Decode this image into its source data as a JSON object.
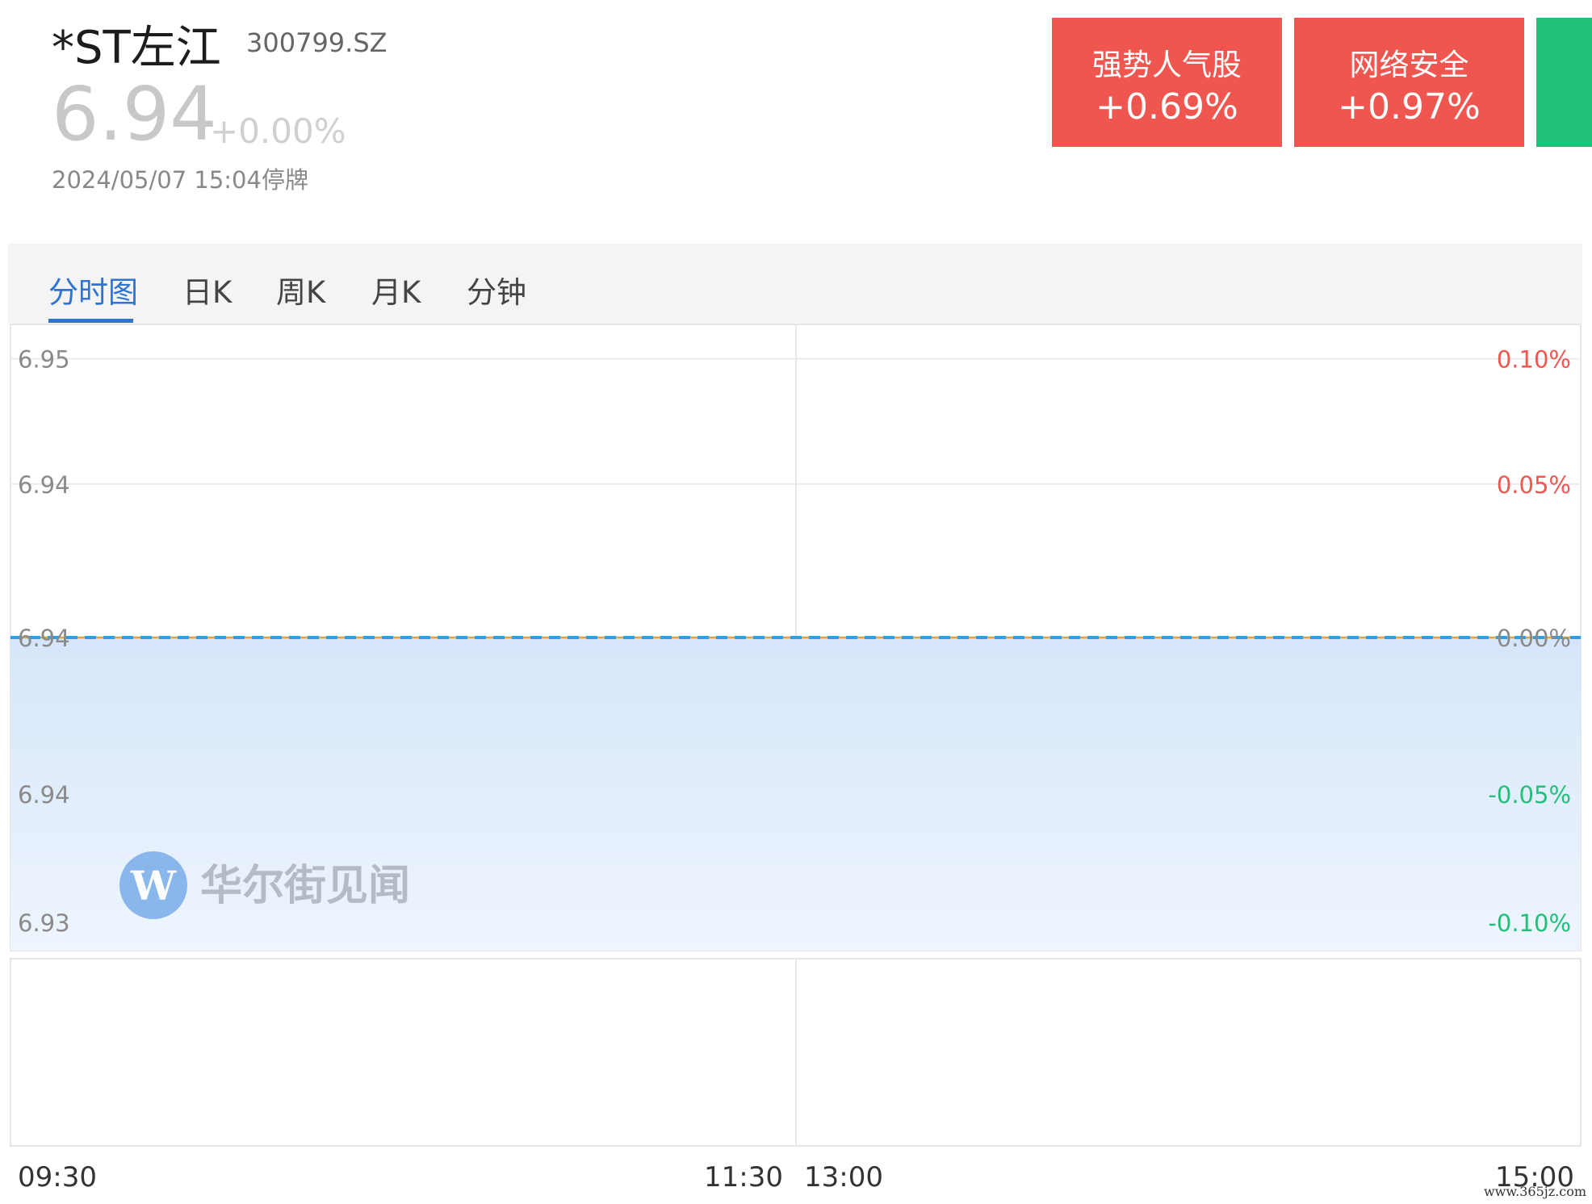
{
  "stock": {
    "name": "*ST左江",
    "code": "300799.SZ",
    "price": "6.94",
    "change_pct": "+0.00%",
    "status": "2024/05/07 15:04停牌"
  },
  "sectors": [
    {
      "name": "强势人气股",
      "pct": "+0.69%"
    },
    {
      "name": "网络安全",
      "pct": "+0.97%"
    }
  ],
  "tabs": [
    {
      "label": "分时图",
      "active": true
    },
    {
      "label": "日K"
    },
    {
      "label": "周K"
    },
    {
      "label": "月K"
    },
    {
      "label": "分钟"
    }
  ],
  "watermark": "华尔街见闻",
  "site_mark": "www.365jz.com",
  "colors": {
    "up": "#f05650",
    "down": "#21c07a",
    "accent": "#2f74d0",
    "price_line": "#2aa1e6",
    "avg_line": "#e6a23c",
    "area_fill": "#d6e6fa"
  },
  "chart_data": {
    "type": "line",
    "title": "",
    "x_ticks": [
      "09:30",
      "11:30",
      "13:00",
      "15:00"
    ],
    "y_left_ticks": [
      "6.95",
      "6.94",
      "6.94",
      "6.94",
      "6.93"
    ],
    "y_right_ticks": [
      "0.10%",
      "0.05%",
      "0.00%",
      "-0.05%",
      "-0.10%"
    ],
    "prev_close": 6.94,
    "ylim": [
      6.933,
      6.947
    ],
    "series": [
      {
        "name": "",
        "x": [
          "09:30",
          "11:30",
          "13:00",
          "15:00"
        ],
        "values": [
          6.94,
          6.94,
          6.94,
          6.94
        ]
      }
    ],
    "grid": true
  }
}
